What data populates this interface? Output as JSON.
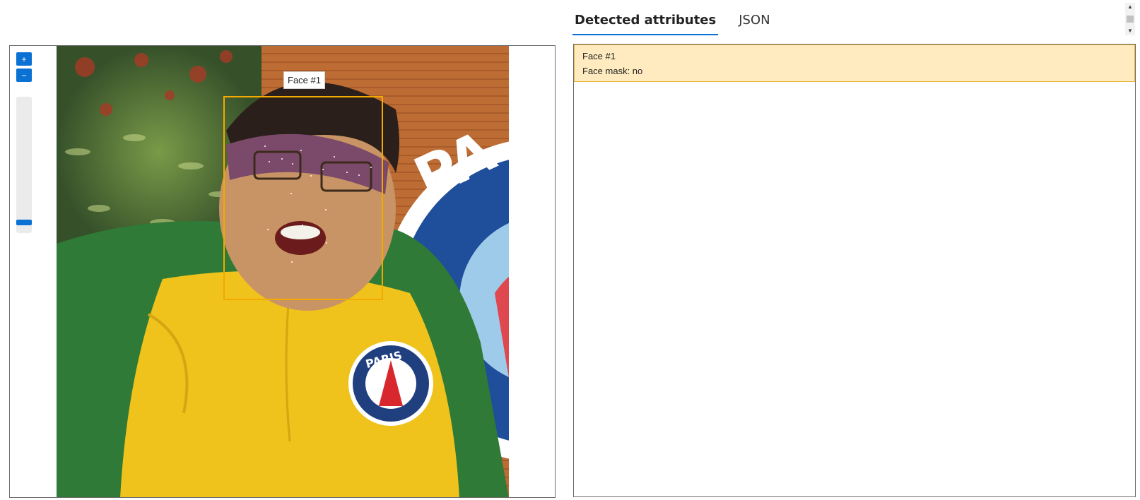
{
  "viewer": {
    "zoom_in_icon": "plus-icon",
    "zoom_out_icon": "minus-icon",
    "zoom_level_fraction": 0.05
  },
  "image": {
    "faces": [
      {
        "tag": "Face #1"
      }
    ]
  },
  "tabs": [
    {
      "label": "Detected attributes",
      "active": true
    },
    {
      "label": "JSON",
      "active": false
    }
  ],
  "results": {
    "faces": [
      {
        "title": "Face #1",
        "attribute": "Face mask: no"
      }
    ]
  },
  "colors": {
    "accent": "#0b72d4",
    "face_box": "#f2a900",
    "highlight": "#ffebbf"
  }
}
